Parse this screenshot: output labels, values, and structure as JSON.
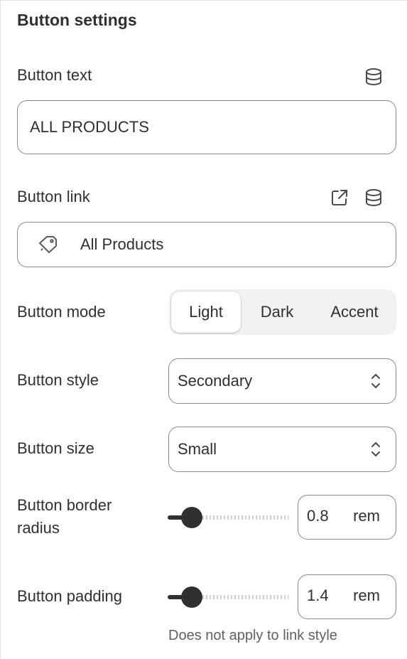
{
  "section": {
    "title": "Button settings"
  },
  "button_text": {
    "label": "Button text",
    "value": "ALL PRODUCTS",
    "dynamic_source_icon": "database-icon"
  },
  "button_link": {
    "label": "Button link",
    "value": "All Products",
    "value_icon": "tag-icon",
    "open_link_icon": "external-link-icon",
    "dynamic_source_icon": "database-icon"
  },
  "button_mode": {
    "label": "Button mode",
    "options": [
      "Light",
      "Dark",
      "Accent"
    ],
    "selected": "Light"
  },
  "button_style": {
    "label": "Button style",
    "value": "Secondary",
    "chevron_icon": "select-chevron-icon"
  },
  "button_size": {
    "label": "Button size",
    "value": "Small",
    "chevron_icon": "select-chevron-icon"
  },
  "border_radius": {
    "label": "Button border radius",
    "value": "0.8",
    "unit": "rem",
    "slider_fraction": 0.2
  },
  "padding": {
    "label": "Button padding",
    "value": "1.4",
    "unit": "rem",
    "slider_fraction": 0.2,
    "help_text": "Does not apply to link style"
  },
  "colors": {
    "text": "#303030",
    "border": "#8a8a8a",
    "segment_bg": "#f1f1f1",
    "help_text": "#616161"
  }
}
